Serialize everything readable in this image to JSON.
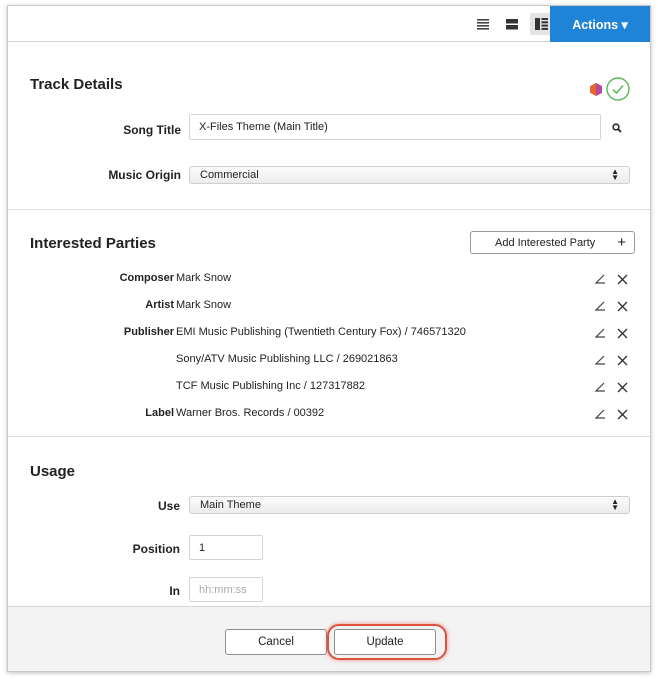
{
  "toolbar": {
    "actions_label": "Actions ▾",
    "view_icons": [
      "list-view-icon",
      "compact-view-icon",
      "split-view-icon"
    ]
  },
  "track": {
    "heading": "Track Details",
    "song_title_label": "Song Title",
    "song_title_value": "X-Files Theme (Main Title)",
    "music_origin_label": "Music Origin",
    "music_origin_value": "Commercial",
    "status_colors": {
      "hex": "#e8662c",
      "check": "#5cb85c"
    }
  },
  "parties": {
    "heading": "Interested Parties",
    "add_label": "Add Interested Party",
    "add_symbol": "+",
    "rows": [
      {
        "role": "Composer",
        "value": "Mark Snow"
      },
      {
        "role": "Artist",
        "value": "Mark Snow"
      },
      {
        "role": "Publisher",
        "value": "EMI Music Publishing (Twentieth Century Fox) / 746571320"
      },
      {
        "role": "",
        "value": "Sony/ATV Music Publishing LLC / 269021863"
      },
      {
        "role": "",
        "value": "TCF Music Publishing Inc / 127317882"
      },
      {
        "role": "Label",
        "value": "Warner Bros. Records / 00392"
      }
    ]
  },
  "usage": {
    "heading": "Usage",
    "use_label": "Use",
    "use_value": "Main Theme",
    "position_label": "Position",
    "position_value": "1",
    "in_label": "In",
    "in_placeholder": "hh:mm:ss"
  },
  "footer": {
    "cancel_label": "Cancel",
    "update_label": "Update"
  },
  "colors": {
    "accent": "#1f83d8",
    "highlight": "#e0503f"
  }
}
